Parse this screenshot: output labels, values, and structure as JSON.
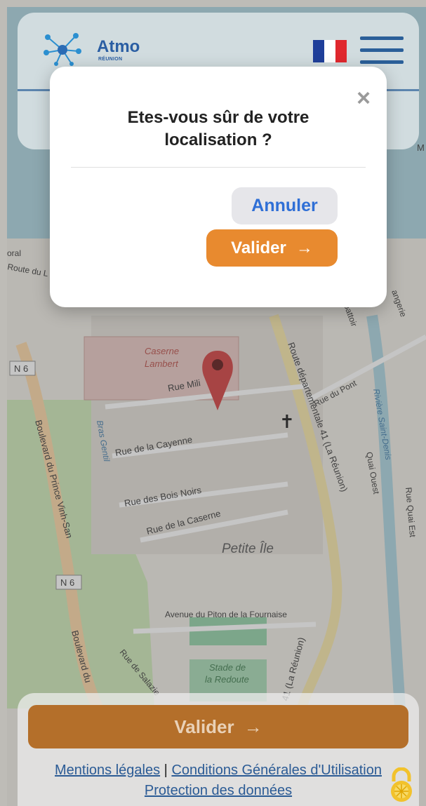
{
  "header": {
    "logo_text": "Atmo",
    "logo_subtext": "RÉUNION",
    "flag_colors": [
      "#1f3f9a",
      "#ffffff",
      "#e0282e"
    ],
    "menu_icon": "hamburger-menu-icon"
  },
  "map": {
    "labels": {
      "caserne": "Caserne",
      "lambert": "Lambert",
      "rue_mili": "Rue Mili",
      "rue_cayenne": "Rue de la Cayenne",
      "rue_bois_noirs": "Rue des Bois Noirs",
      "rue_caserne": "Rue de la Caserne",
      "petite_ile": "Petite Île",
      "avenue_piton": "Avenue du Piton de la Fournaise",
      "route_dep": "Route départementale 41 (La Réunion)",
      "rue_du_pont": "Rue du Pont",
      "riviere": "Rivière Saint-Denis",
      "quai_ouest": "Quai Ouest",
      "rue_quai_est": "Rue Quai Est",
      "boulevard_prince": "Boulevard du Prince Vinh-San",
      "boulevard_du": "Boulevard du",
      "n6": "N 6",
      "bras_gentil": "Bras Gentil",
      "stade_de": "Stade de",
      "la_redoute": "la Redoute",
      "rue_salazie": "Rue de Salazie",
      "d41": "41 (La Réunion)",
      "toral": "oral",
      "route_du": "Route du L",
      "battoir": "battoir",
      "angerie": "angerie",
      "m_a": "M"
    }
  },
  "modal": {
    "title": "Etes-vous sûr de votre localisation ?",
    "close_symbol": "×",
    "cancel_label": "Annuler",
    "validate_label": "Valider",
    "validate_arrow": "→"
  },
  "bottom": {
    "validate_label": "Valider",
    "validate_arrow": "→",
    "link_legal": "Mentions légales",
    "separator": "|",
    "link_cgu": "Conditions Générales d'Utilisation",
    "link_privacy": "Protection des données",
    "lock_icon": "lock-icon"
  },
  "colors": {
    "accent_orange": "#e88a2f",
    "brand_blue": "#2b5f99",
    "link_blue": "#2f6fd6"
  }
}
